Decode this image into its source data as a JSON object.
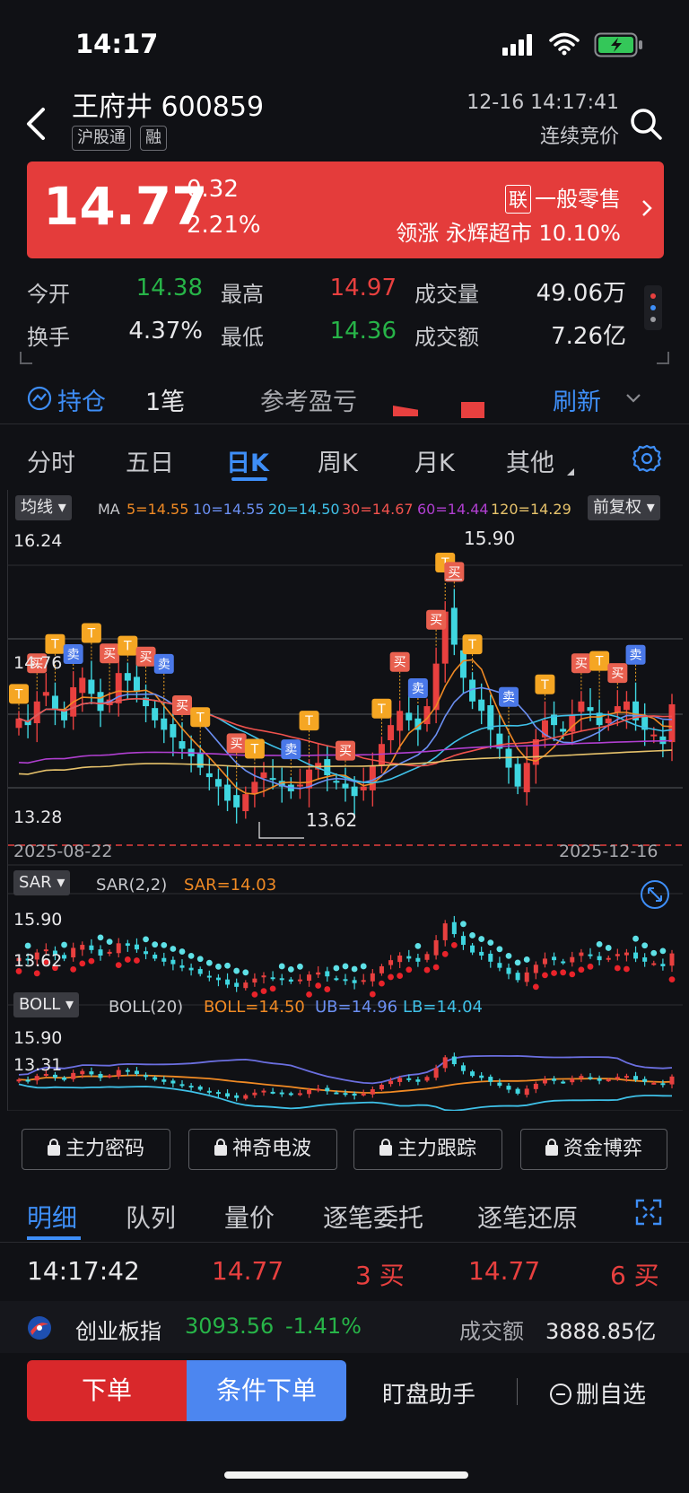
{
  "status": {
    "time": "14:17"
  },
  "header": {
    "title": "王府井 600859",
    "tags": [
      "沪股通",
      "融"
    ],
    "timestamp": "12-16 14:17:41",
    "state": "连续竞价"
  },
  "quote": {
    "price": "14.77",
    "change": "0.32",
    "change_pct": "2.21%",
    "sector_badge": "联",
    "sector": "一般零售",
    "leader": "领涨 永辉超市 10.10%"
  },
  "stats": {
    "open_label": "今开",
    "open": "14.38",
    "high_label": "最高",
    "high": "14.97",
    "volume_label": "成交量",
    "volume": "49.06万",
    "turnover_label": "换手",
    "turnover": "4.37%",
    "low_label": "最低",
    "low": "14.36",
    "amount_label": "成交额",
    "amount": "7.26亿"
  },
  "position": {
    "label": "持仓",
    "count": "1笔",
    "pnl_label": "参考盈亏",
    "refresh": "刷新"
  },
  "period_tabs": [
    "分时",
    "五日",
    "日K",
    "周K",
    "月K",
    "其他"
  ],
  "kline": {
    "indicator": "均线",
    "ma_label": "MA",
    "ma": [
      {
        "text": "5=14.55",
        "color": "#f08a24"
      },
      {
        "text": "10=14.55",
        "color": "#6b8ff2"
      },
      {
        "text": "20=14.50",
        "color": "#3fc1e8"
      },
      {
        "text": "30=14.67",
        "color": "#f0524d"
      },
      {
        "text": "60=14.44",
        "color": "#b03fd0"
      },
      {
        "text": "120=14.29",
        "color": "#e6c26b"
      }
    ],
    "adjust": "前复权",
    "high_label": "16.24",
    "peak_value": "15.90",
    "mid_label": "14.76",
    "low_label": "13.28",
    "trough_value": "13.62",
    "start_date": "2025-08-22",
    "end_date": "2025-12-16",
    "buy_marker": "买",
    "sell_marker": "卖",
    "t_marker": "T"
  },
  "sar": {
    "indicator": "SAR",
    "params": "SAR(2,2)",
    "value": "SAR=14.03",
    "top": "15.90",
    "bottom": "13.62"
  },
  "boll": {
    "indicator": "BOLL",
    "params": "BOLL(20)",
    "mid": "BOLL=14.50",
    "ub": "UB=14.96",
    "lb": "LB=14.04",
    "top": "15.90",
    "bottom": "13.31"
  },
  "tools": [
    "主力密码",
    "神奇电波",
    "主力跟踪",
    "资金博弈"
  ],
  "detail_tabs": [
    "明细",
    "队列",
    "量价",
    "逐笔委托",
    "逐笔还原"
  ],
  "trade": {
    "time": "14:17:42",
    "price1": "14.77",
    "vol1": "3 买",
    "price2": "14.77",
    "vol2": "6 买"
  },
  "index": {
    "name": "创业板指",
    "value": "3093.56",
    "change": "-1.41%",
    "amount_label": "成交额",
    "amount": "3888.85亿"
  },
  "actions": {
    "order": "下单",
    "conditional_order": "条件下单",
    "watch": "盯盘助手",
    "remove": "删自选"
  },
  "colors": {
    "up": "#e8403f",
    "down": "#27b448",
    "accent": "#3e8ef7",
    "banner": "#e43c3b"
  },
  "chart_data": {
    "type": "candlestick",
    "title": "",
    "xlabel": "",
    "ylabel": "",
    "x_range": [
      "2025-08-22",
      "2025-12-16"
    ],
    "ylim": [
      13.28,
      16.24
    ],
    "closes": [
      14.62,
      14.55,
      14.8,
      14.9,
      14.72,
      14.6,
      14.95,
      15.05,
      14.88,
      14.7,
      14.82,
      15.1,
      15.02,
      14.9,
      14.75,
      14.6,
      14.5,
      14.42,
      14.3,
      14.22,
      14.1,
      14.0,
      13.9,
      13.75,
      13.68,
      13.82,
      13.95,
      14.05,
      13.98,
      13.9,
      13.85,
      13.92,
      14.08,
      14.15,
      14.02,
      13.95,
      13.88,
      13.8,
      13.9,
      14.12,
      14.35,
      14.55,
      14.7,
      14.6,
      14.5,
      14.75,
      15.2,
      15.75,
      15.4,
      15.05,
      14.8,
      14.7,
      14.5,
      14.3,
      14.1,
      13.9,
      14.15,
      14.4,
      14.6,
      14.55,
      14.48,
      14.65,
      14.8,
      14.7,
      14.55,
      14.62,
      14.75,
      14.8,
      14.6,
      14.5,
      14.45,
      14.35,
      14.77
    ]
  }
}
